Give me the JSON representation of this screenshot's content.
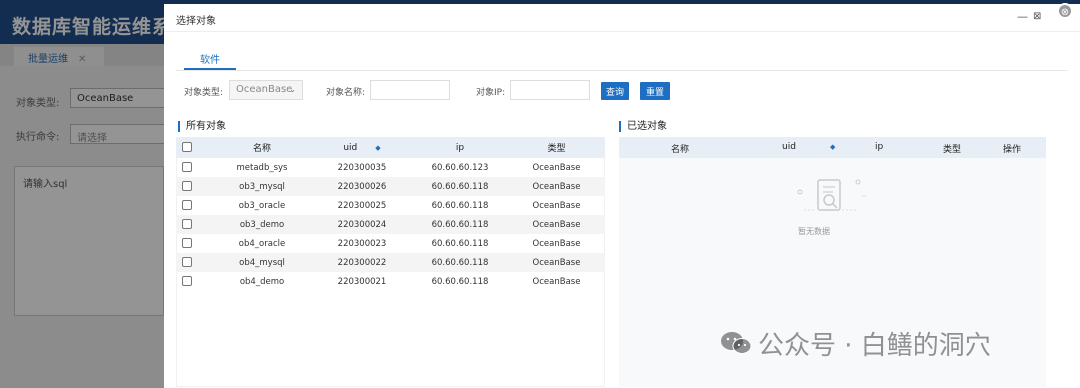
{
  "background": {
    "app_title": "数据库智能运维系",
    "tab_label": "批量运维",
    "tab_close": "✕",
    "object_type_label": "对象类型:",
    "object_type_value": "OceanBase",
    "command_label": "执行命令:",
    "command_placeholder": "请选择",
    "sql_placeholder": "请输入sql"
  },
  "modal": {
    "title": "选择对象",
    "minimize": "—",
    "maximize": "⊠",
    "close": "⊗",
    "tab": "软件",
    "filters": {
      "type_label": "对象类型:",
      "type_value": "OceanBase",
      "name_label": "对象名称:",
      "ip_label": "对象IP:",
      "query_button": "查询",
      "reset_button": "重置"
    },
    "left": {
      "title": "所有对象",
      "headers": [
        "名称",
        "uid",
        "ip",
        "类型"
      ],
      "rows": [
        {
          "name": "metadb_sys",
          "uid": "220300035",
          "ip": "60.60.60.123",
          "type": "OceanBase"
        },
        {
          "name": "ob3_mysql",
          "uid": "220300026",
          "ip": "60.60.60.118",
          "type": "OceanBase"
        },
        {
          "name": "ob3_oracle",
          "uid": "220300025",
          "ip": "60.60.60.118",
          "type": "OceanBase"
        },
        {
          "name": "ob3_demo",
          "uid": "220300024",
          "ip": "60.60.60.118",
          "type": "OceanBase"
        },
        {
          "name": "ob4_oracle",
          "uid": "220300023",
          "ip": "60.60.60.118",
          "type": "OceanBase"
        },
        {
          "name": "ob4_mysql",
          "uid": "220300022",
          "ip": "60.60.60.118",
          "type": "OceanBase"
        },
        {
          "name": "ob4_demo",
          "uid": "220300021",
          "ip": "60.60.60.118",
          "type": "OceanBase"
        }
      ]
    },
    "right": {
      "title": "已选对象",
      "headers": [
        "名称",
        "uid",
        "ip",
        "类型",
        "操作"
      ],
      "empty_text": "暂无数据"
    }
  },
  "watermark": "公众号 · 白鳝的洞穴"
}
